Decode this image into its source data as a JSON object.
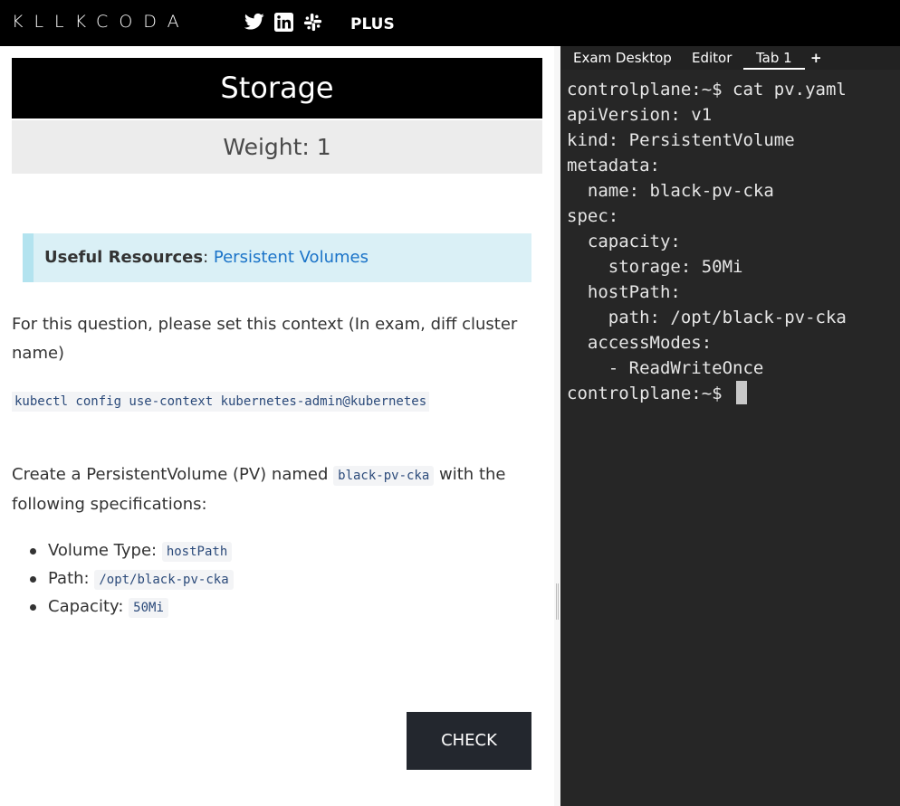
{
  "header": {
    "logo_text": "KLLKCODA",
    "plus_label": "PLUS",
    "social_icons": [
      "twitter-icon",
      "linkedin-icon",
      "slack-icon"
    ]
  },
  "scenario": {
    "title": "Storage",
    "weight": "Weight: 1",
    "resources_label": "Useful Resources",
    "resources_sep": ":",
    "resources_link": "Persistent Volumes",
    "context_text": "For this question, please set this context (In exam, diff cluster name)",
    "context_command": "kubectl config use-context kubernetes-admin@kubernetes",
    "task_prefix": "Create a PersistentVolume (PV) named",
    "task_pv_name": "black-pv-cka",
    "task_suffix": "with the following specifications:",
    "specs": [
      {
        "label": "Volume Type:",
        "value": "hostPath"
      },
      {
        "label": "Path:",
        "value": "/opt/black-pv-cka"
      },
      {
        "label": "Capacity:",
        "value": "50Mi"
      }
    ],
    "check_label": "CHECK"
  },
  "terminal": {
    "tabs": [
      "Exam Desktop",
      "Editor",
      "Tab 1",
      "+"
    ],
    "active_tab": "Tab 1",
    "lines": [
      "controlplane:~$ cat pv.yaml",
      "apiVersion: v1",
      "kind: PersistentVolume",
      "metadata:",
      "  name: black-pv-cka",
      "spec:",
      "  capacity:",
      "    storage: 50Mi",
      "  hostPath:",
      "    path: /opt/black-pv-cka",
      "  accessModes:",
      "    - ReadWriteOnce"
    ],
    "prompt": "controlplane:~$ "
  },
  "colors": {
    "topbar": "#000000",
    "terminal_bg": "#262626",
    "link": "#1a73c8",
    "check_button": "#23272e",
    "resources_bg": "#daf0f6"
  }
}
